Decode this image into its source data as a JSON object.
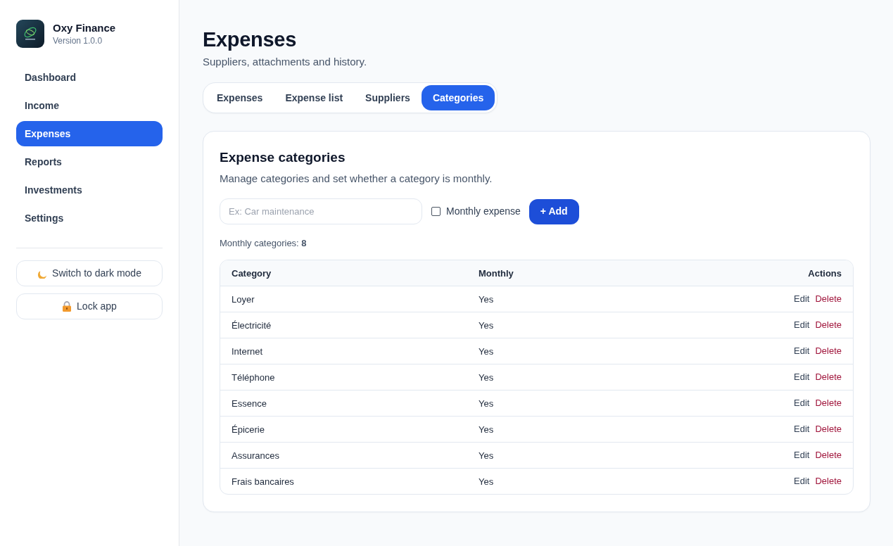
{
  "sidebar": {
    "app_name": "Oxy Finance",
    "version": "Version 1.0.0",
    "items": [
      {
        "label": "Dashboard",
        "selected": false
      },
      {
        "label": "Income",
        "selected": false
      },
      {
        "label": "Expenses",
        "selected": true
      },
      {
        "label": "Reports",
        "selected": false
      },
      {
        "label": "Investments",
        "selected": false
      },
      {
        "label": "Settings",
        "selected": false
      }
    ],
    "buttons": [
      {
        "kind": "theme",
        "label": "Switch to dark mode"
      },
      {
        "kind": "lock",
        "label": "Lock app"
      }
    ]
  },
  "header": {
    "title": "Expenses",
    "subtitle": "Suppliers, attachments and history."
  },
  "tabs": [
    {
      "label": "Expenses",
      "selected": false
    },
    {
      "label": "Expense list",
      "selected": false
    },
    {
      "label": "Suppliers",
      "selected": false
    },
    {
      "label": "Categories",
      "selected": true
    }
  ],
  "card": {
    "title": "Expense categories",
    "description": "Manage categories and set whether a category is monthly.",
    "form": {
      "name_field": {
        "placeholder": "Ex: Car maintenance"
      },
      "monthly_checkbox": {
        "label": "Monthly expense",
        "checked": false
      },
      "add_button": "+ Add"
    },
    "summary": "Monthly categories: **8**",
    "table": {
      "columns": [
        "Category",
        "Monthly",
        "Actions"
      ],
      "rows": [
        {
          "category": "Loyer",
          "monthly": "Yes",
          "actions": [
            {
              "kind": "edit",
              "label": "Edit"
            },
            {
              "kind": "delete",
              "label": "Delete"
            }
          ]
        },
        {
          "category": "Électricité",
          "monthly": "Yes",
          "actions": [
            {
              "kind": "edit",
              "label": "Edit"
            },
            {
              "kind": "delete",
              "label": "Delete"
            }
          ]
        },
        {
          "category": "Internet",
          "monthly": "Yes",
          "actions": [
            {
              "kind": "edit",
              "label": "Edit"
            },
            {
              "kind": "delete",
              "label": "Delete"
            }
          ]
        },
        {
          "category": "Téléphone",
          "monthly": "Yes",
          "actions": [
            {
              "kind": "edit",
              "label": "Edit"
            },
            {
              "kind": "delete",
              "label": "Delete"
            }
          ]
        },
        {
          "category": "Essence",
          "monthly": "Yes",
          "actions": [
            {
              "kind": "edit",
              "label": "Edit"
            },
            {
              "kind": "delete",
              "label": "Delete"
            }
          ]
        },
        {
          "category": "Épicerie",
          "monthly": "Yes",
          "actions": [
            {
              "kind": "edit",
              "label": "Edit"
            },
            {
              "kind": "delete",
              "label": "Delete"
            }
          ]
        },
        {
          "category": "Assurances",
          "monthly": "Yes",
          "actions": [
            {
              "kind": "edit",
              "label": "Edit"
            },
            {
              "kind": "delete",
              "label": "Delete"
            }
          ]
        },
        {
          "category": "Frais bancaires",
          "monthly": "Yes",
          "actions": [
            {
              "kind": "edit",
              "label": "Edit"
            },
            {
              "kind": "delete",
              "label": "Delete"
            }
          ]
        }
      ]
    }
  }
}
